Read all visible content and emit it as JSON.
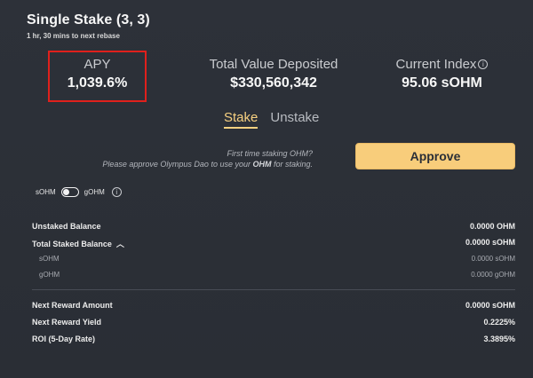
{
  "header": {
    "title": "Single Stake (3, 3)",
    "subtitle": "1 hr, 30 mins to next rebase"
  },
  "metrics": {
    "apy": {
      "label": "APY",
      "value": "1,039.6%"
    },
    "tvd": {
      "label": "Total Value Deposited",
      "value": "$330,560,342"
    },
    "index": {
      "label": "Current Index",
      "value": "95.06 sOHM",
      "icon": "info-icon"
    }
  },
  "tabs": [
    {
      "label": "Stake",
      "active": true
    },
    {
      "label": "Unstake",
      "active": false
    }
  ],
  "approve": {
    "line1": "First time staking OHM?",
    "line2_pre": "Please approve Olympus Dao to use your ",
    "line2_bold": "OHM",
    "line2_post": " for staking.",
    "button_label": "Approve"
  },
  "toggle": {
    "left_label": "sOHM",
    "right_label": "gOHM",
    "icon": "info-icon"
  },
  "balances": {
    "unstaked": {
      "label": "Unstaked Balance",
      "value": "0.0000 OHM"
    },
    "total_staked": {
      "label": "Total Staked Balance",
      "value": "0.0000 sOHM",
      "icon": "chevron-up-icon"
    },
    "sohm": {
      "label": "sOHM",
      "value": "0.0000 sOHM"
    },
    "gohm": {
      "label": "gOHM",
      "value": "0.0000 gOHM"
    }
  },
  "rewards": {
    "next_amount": {
      "label": "Next Reward Amount",
      "value": "0.0000 sOHM"
    },
    "next_yield": {
      "label": "Next Reward Yield",
      "value": "0.2225%"
    },
    "roi": {
      "label": "ROI (5-Day Rate)",
      "value": "3.3895%"
    }
  },
  "colors": {
    "accent": "#f8d181",
    "button": "#f8cd7b",
    "highlight_box": "#e0201c",
    "background": "#2b2f37"
  }
}
